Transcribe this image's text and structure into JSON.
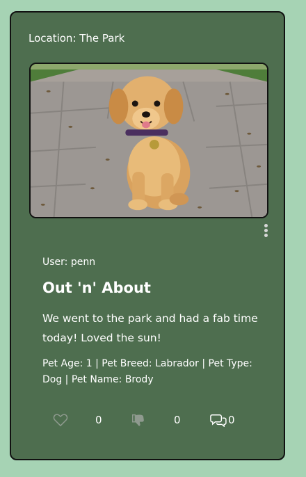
{
  "post": {
    "location_label": "Location: The Park",
    "image_alt": "Golden puppy sitting on a stone path in a park",
    "user_label": "User: penn",
    "title": "Out 'n' About",
    "description": "We went to the park and had a fab time today! Loved the sun!",
    "details": "Pet Age: 1 | Pet Breed: Labrador | Pet Type: Dog | Pet Name: Brody",
    "likes": "0",
    "dislikes": "0",
    "comments": "0"
  },
  "icons": {
    "menu": "kebab-menu-icon",
    "like": "heart-icon",
    "dislike": "thumbs-down-icon",
    "comment": "comments-icon"
  },
  "colors": {
    "page_background": "#a6d3b4",
    "card_background": "#4e6e4f",
    "text": "#ffffff",
    "icon_muted": "#8f9a8f"
  }
}
